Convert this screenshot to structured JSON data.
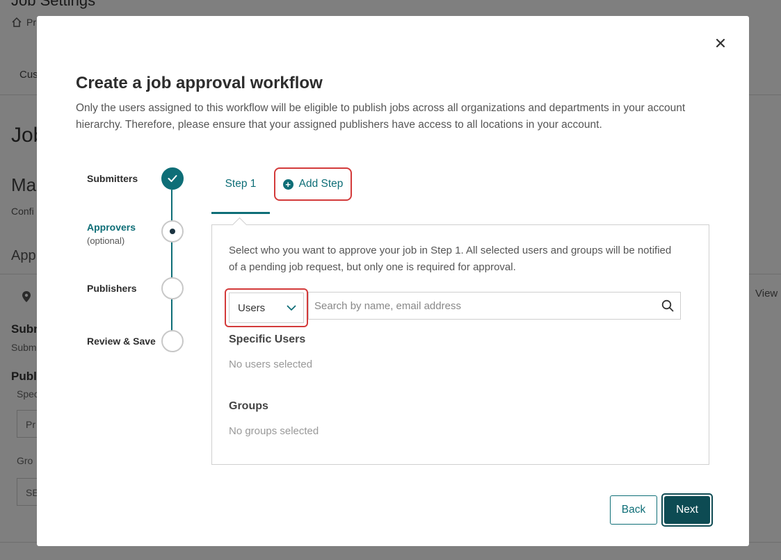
{
  "background": {
    "page_title": "Job Settings",
    "breadcrumb": "Pr",
    "tab": "Cus",
    "heading": "Job",
    "subheading": "Ma",
    "config_text": "Confi",
    "approvals_heading": "App",
    "view_link": "View",
    "submitters_heading": "Subm",
    "submitters_text": "Subm",
    "publishers_heading": "Publ",
    "specific_label": "Spec",
    "specific_value": "Pr",
    "groups_label": "Gro",
    "groups_value": "SE"
  },
  "modal": {
    "close_label": "×",
    "title": "Create a job approval workflow",
    "description": "Only the users assigned to this workflow will be eligible to publish jobs across all organizations and departments in your account hierarchy. Therefore, please ensure that your assigned publishers have access to all locations in your account.",
    "stepper": {
      "steps": [
        {
          "label": "Submitters",
          "sub": "",
          "state": "done"
        },
        {
          "label": "Approvers",
          "sub": "(optional)",
          "state": "current"
        },
        {
          "label": "Publishers",
          "sub": "",
          "state": "pending"
        },
        {
          "label": "Review & Save",
          "sub": "",
          "state": "pending"
        }
      ]
    },
    "tabs": {
      "step1_label": "Step 1",
      "add_step_label": "Add Step"
    },
    "panel": {
      "description": "Select who you want to approve your job in Step 1. All selected users and groups will be notified of a pending job request, but only one is required for approval.",
      "type_select_value": "Users",
      "search_placeholder": "Search by name, email address",
      "specific_users_title": "Specific Users",
      "specific_users_empty": "No users selected",
      "groups_title": "Groups",
      "groups_empty": "No groups selected"
    },
    "footer": {
      "back_label": "Back",
      "next_label": "Next"
    }
  },
  "colors": {
    "accent": "#0e6e77",
    "primary_button": "#0d4b53",
    "highlight_border": "#d33a3a"
  }
}
